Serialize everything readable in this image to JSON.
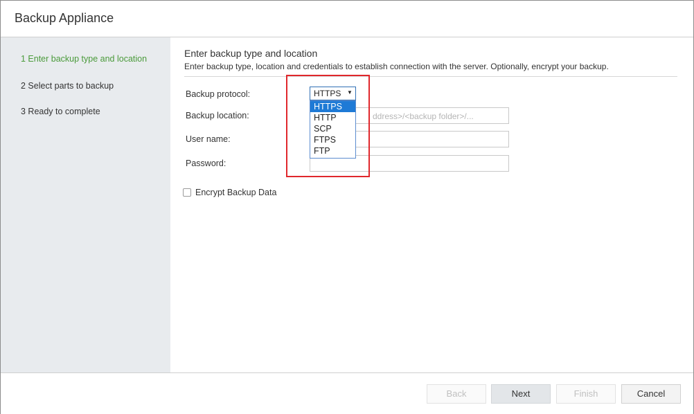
{
  "window": {
    "title": "Backup Appliance"
  },
  "steps": [
    {
      "label": "1 Enter backup type and location",
      "active": true
    },
    {
      "label": "2 Select parts to backup",
      "active": false
    },
    {
      "label": "3 Ready to complete",
      "active": false
    }
  ],
  "content": {
    "title": "Enter backup type and location",
    "description": "Enter backup type, location and credentials to establish connection with the server. Optionally, encrypt your backup."
  },
  "form": {
    "protocol_label": "Backup protocol:",
    "protocol_value": "HTTPS",
    "protocol_options": [
      "HTTPS",
      "HTTP",
      "SCP",
      "FTPS",
      "FTP"
    ],
    "location_label": "Backup location:",
    "location_placeholder": "ddress>/<backup folder>/...",
    "username_label": "User name:",
    "password_label": "Password:",
    "encrypt_label": "Encrypt Backup Data"
  },
  "footer": {
    "back": "Back",
    "next": "Next",
    "finish": "Finish",
    "cancel": "Cancel"
  },
  "colors": {
    "active_step": "#4a9a3a",
    "selected_option": "#1e7ad6",
    "highlight_box": "#e0272c"
  }
}
